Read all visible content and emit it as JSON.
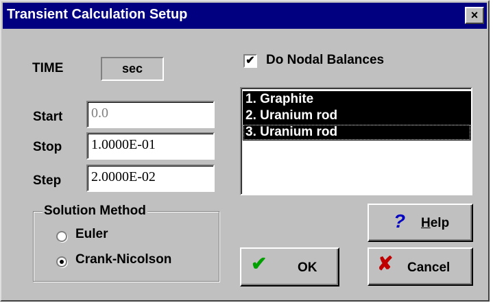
{
  "window": {
    "title": "Transient Calculation Setup",
    "close_glyph": "×"
  },
  "time": {
    "label": "TIME",
    "unit": "sec"
  },
  "start": {
    "label": "Start",
    "value": "0.0"
  },
  "stop": {
    "label": "Stop",
    "value": "1.0000E-01"
  },
  "step": {
    "label": "Step",
    "value": "2.0000E-02"
  },
  "solution": {
    "legend": "Solution Method",
    "options": [
      {
        "label": "Euler",
        "selected": false
      },
      {
        "label": "Crank-Nicolson",
        "selected": true
      }
    ]
  },
  "nodal": {
    "label": "Do Nodal Balances",
    "checked": true,
    "check_glyph": "✔"
  },
  "list": {
    "items": [
      "1. Graphite",
      "2. Uranium rod",
      "3. Uranium rod"
    ]
  },
  "buttons": {
    "help": {
      "label_mnemonic": "H",
      "label_rest": "elp",
      "icon": "question-icon",
      "glyph": "?"
    },
    "ok": {
      "label": "OK",
      "icon": "checkmark-icon",
      "glyph": "✔"
    },
    "cancel": {
      "label": "Cancel",
      "icon": "x-icon",
      "glyph": "✘"
    }
  },
  "colors": {
    "titlebar": "#000080",
    "face": "#c0c0c0",
    "ok_icon": "#00a000",
    "cancel_icon": "#c00000",
    "help_icon": "#0000c0"
  }
}
